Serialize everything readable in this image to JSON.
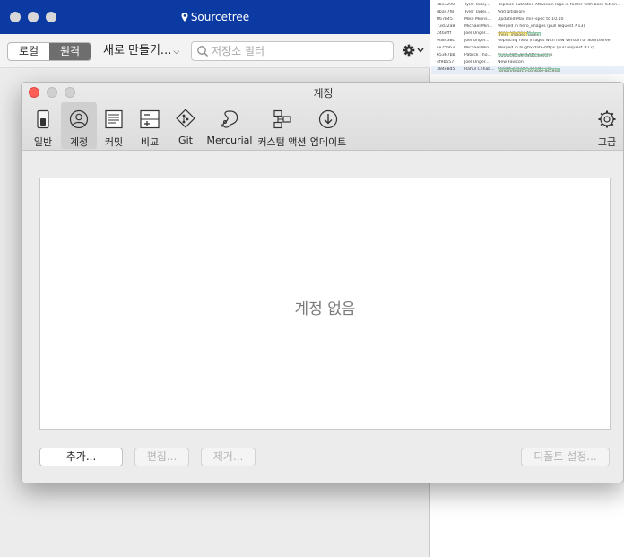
{
  "main_window": {
    "title": "Sourcetree",
    "segment": {
      "local": "로컬",
      "remote": "원격",
      "active": "remote"
    },
    "new_menu": "새로 만들기...",
    "search_placeholder": "저장소 필터"
  },
  "commit_log": {
    "rows": [
      {
        "hash": "3bc3290",
        "author": "Tyler Tadej...",
        "tags": [],
        "message": "Replace outdated Atlassian logo in footer with base-64 en..."
      },
      {
        "hash": "dba47f8",
        "author": "Tyler Tadej...",
        "tags": [],
        "message": "Add gitignore"
      },
      {
        "hash": "ff67b45",
        "author": "Mike Minns...",
        "tags": [],
        "message": "Updated Mac min-spec to 10.10"
      },
      {
        "hash": "73d32a8",
        "author": "Michael Min...",
        "tags": [],
        "message": "Merged in hero_images (pull request #13)"
      },
      {
        "hash": "246cfff",
        "author": "Joel Unger...",
        "tags": [
          "origin/hero_images",
          "hero_images"
        ],
        "message": "Used Tinypng to c..."
      },
      {
        "hash": "9d8438c",
        "author": "Joel Unger...",
        "tags": [],
        "message": "Replacing hero images with new version of SourceTree"
      },
      {
        "hash": "ce75b63",
        "author": "Michael Min...",
        "tags": [],
        "message": "Merged in bugfix/date-https (pull request #12)"
      },
      {
        "hash": "65367bb",
        "author": "Patrick Tho...",
        "tags": [
          "origin/bugfix/date-https"
        ],
        "message": "fixed date and https errors"
      },
      {
        "hash": "4f9b557",
        "author": "Joel Unger...",
        "tags": [],
        "message": "New Favicon"
      },
      {
        "hash": "384e8d5",
        "author": "Rahul Chhab...",
        "tags": [
          "origin/search-console-access"
        ],
        "message": "search console google ver..."
      }
    ]
  },
  "dialog": {
    "title": "계정",
    "tabs": [
      {
        "id": "general",
        "label": "일반",
        "icon": "switch-icon"
      },
      {
        "id": "accounts",
        "label": "계정",
        "icon": "account-icon"
      },
      {
        "id": "commit",
        "label": "커밋",
        "icon": "document-icon"
      },
      {
        "id": "diff",
        "label": "비교",
        "icon": "diff-icon"
      },
      {
        "id": "git",
        "label": "Git",
        "icon": "git-icon"
      },
      {
        "id": "mercurial",
        "label": "Mercurial",
        "icon": "mercurial-icon"
      },
      {
        "id": "custom_actions",
        "label": "커스텀 액션",
        "icon": "custom-actions-icon"
      },
      {
        "id": "update",
        "label": "업데이트",
        "icon": "download-icon"
      },
      {
        "id": "advanced",
        "label": "고급",
        "icon": "gear-icon"
      }
    ],
    "selected_tab": "accounts",
    "empty_text": "계정 없음",
    "buttons": {
      "add": "추가...",
      "edit": "편집...",
      "remove": "제거...",
      "set_default": "디폴트 설정..."
    }
  }
}
